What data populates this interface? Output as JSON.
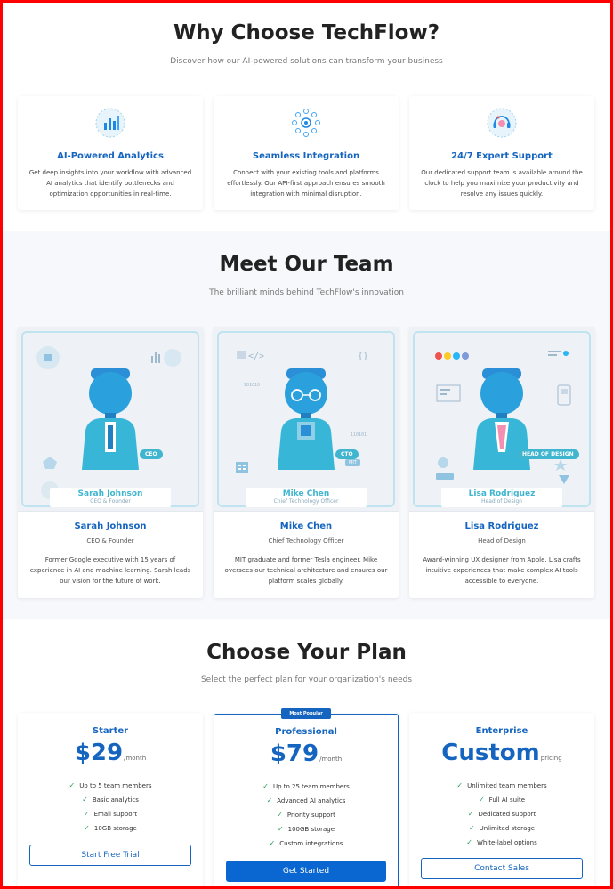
{
  "why": {
    "title": "Why Choose TechFlow?",
    "subtitle": "Discover how our AI-powered solutions can transform your business",
    "features": [
      {
        "icon": "analytics-chart-icon",
        "title": "AI-Powered Analytics",
        "desc": "Get deep insights into your workflow with advanced AI analytics that identify bottlenecks and optimization opportunities in real-time."
      },
      {
        "icon": "integration-network-icon",
        "title": "Seamless Integration",
        "desc": "Connect with your existing tools and platforms effortlessly. Our API-first approach ensures smooth integration with minimal disruption."
      },
      {
        "icon": "support-headset-icon",
        "title": "24/7 Expert Support",
        "desc": "Our dedicated support team is available around the clock to help you maximize your productivity and resolve any issues quickly."
      }
    ]
  },
  "team": {
    "title": "Meet Our Team",
    "subtitle": "The brilliant minds behind TechFlow's innovation",
    "members": [
      {
        "badge": "CEO",
        "name": "Sarah Johnson",
        "role": "CEO & Founder",
        "bio": "Former Google executive with 15 years of experience in AI and machine learning. Sarah leads our vision for the future of work.",
        "color": "#3fb5cf"
      },
      {
        "badge": "CTO",
        "name": "Mike Chen",
        "role": "Chief Technology Officer",
        "bio": "MIT graduate and former Tesla engineer. Mike oversees our technical architecture and ensures our platform scales globally.",
        "color": "#3fb5cf",
        "decor": [
          "101010",
          "110101"
        ],
        "mini_badge": "MIT"
      },
      {
        "badge": "HEAD OF DESIGN",
        "name": "Lisa Rodriguez",
        "role": "Head of Design",
        "bio": "Award-winning UX designer from Apple. Lisa crafts intuitive experiences that make complex AI tools accessible to everyone.",
        "color": "#3fb5cf"
      }
    ]
  },
  "plans": {
    "title": "Choose Your Plan",
    "subtitle": "Select the perfect plan for your organization's needs",
    "popular_label": "Most Popular",
    "items": [
      {
        "name": "Starter",
        "price": "$29",
        "period": "/month",
        "features": [
          "Up to 5 team members",
          "Basic analytics",
          "Email support",
          "10GB storage"
        ],
        "cta": "Start Free Trial"
      },
      {
        "name": "Professional",
        "price": "$79",
        "period": "/month",
        "features": [
          "Up to 25 team members",
          "Advanced AI analytics",
          "Priority support",
          "100GB storage",
          "Custom integrations"
        ],
        "cta": "Get Started"
      },
      {
        "name": "Enterprise",
        "price": "Custom",
        "period": "pricing",
        "features": [
          "Unlimited team members",
          "Full AI suite",
          "Dedicated support",
          "Unlimited storage",
          "White-label options"
        ],
        "cta": "Contact Sales"
      }
    ]
  },
  "colors": {
    "accent": "#1565c0",
    "teal": "#3fb5cf",
    "check": "#2e9e5b",
    "frame": "#ff0000"
  }
}
